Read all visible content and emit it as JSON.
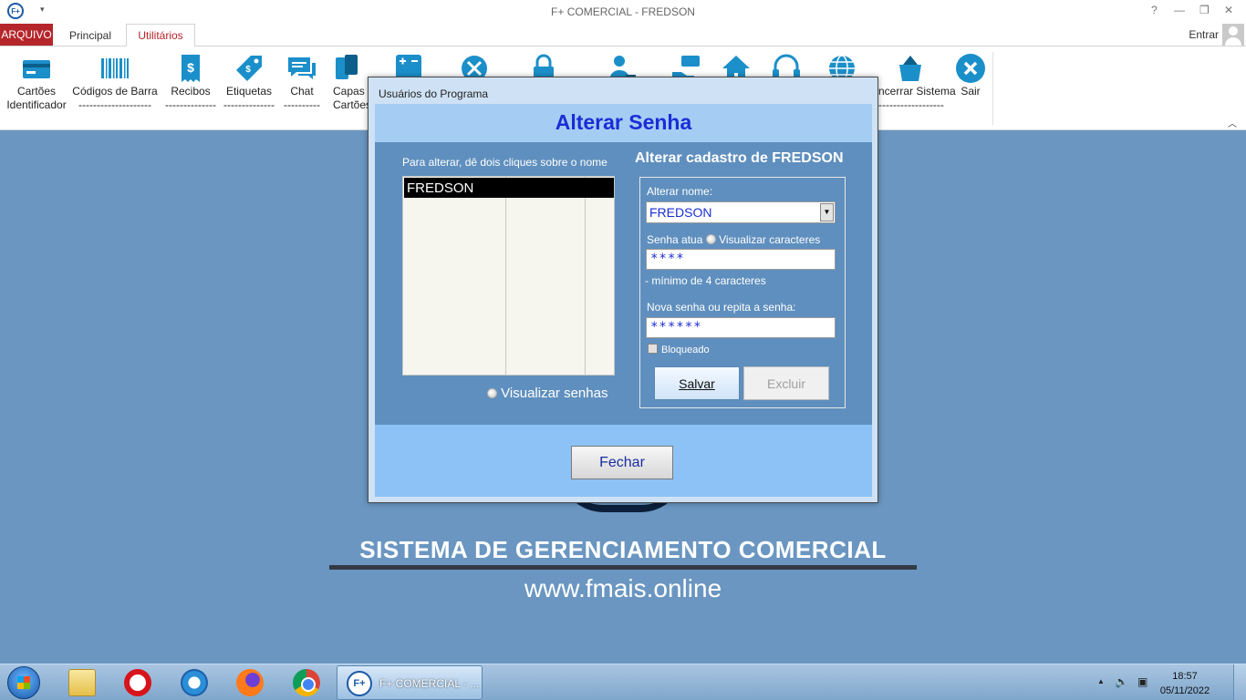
{
  "window": {
    "title": "F+ COMERCIAL - FREDSON",
    "logo_text": "F+",
    "help": "?",
    "minimize": "—",
    "restore": "❐",
    "close": "✕"
  },
  "ribbon": {
    "file_tab": "ARQUIVO",
    "tabs": [
      "Principal",
      "Utilitários"
    ],
    "active_tab": "Utilitários",
    "login_label": "Entrar",
    "buttons": [
      {
        "line1": "Cartões",
        "line2": "Identificador",
        "icon": "card-id-icon"
      },
      {
        "line1": "Códigos de Barra",
        "line2": "--------------------",
        "icon": "barcode-icon"
      },
      {
        "line1": "Recibos",
        "line2": "--------------",
        "icon": "receipt-icon"
      },
      {
        "line1": "Etiquetas",
        "line2": "--------------",
        "icon": "tags-icon"
      },
      {
        "line1": "Chat",
        "line2": "----------",
        "icon": "chat-icon"
      },
      {
        "line1": "Capas e",
        "line2": "Cartões",
        "icon": "card-covers-icon"
      },
      {
        "line1": "",
        "line2": "",
        "icon": "calculator-icon"
      },
      {
        "line1": "",
        "line2": "",
        "icon": "tools-icon"
      },
      {
        "line1": "",
        "line2": "",
        "icon": "lock-icon"
      },
      {
        "line1": "",
        "line2": "",
        "icon": "user-lock-icon"
      },
      {
        "line1": "",
        "line2": "",
        "icon": "payment-icon"
      },
      {
        "line1": "",
        "line2": "",
        "icon": "home-icon"
      },
      {
        "line1": "",
        "line2": "",
        "icon": "headset-icon"
      },
      {
        "line1": "",
        "line2": "",
        "icon": "globe-icon"
      },
      {
        "line1": "Encerrar Sistema",
        "line2": "--------------------",
        "icon": "close-system-icon"
      },
      {
        "line1": "Sair",
        "line2": "",
        "icon": "exit-icon"
      }
    ]
  },
  "background": {
    "heading": "SISTEMA DE GERENCIAMENTO COMERCIAL",
    "url": "www.fmais.online"
  },
  "dialog": {
    "title": "Usuários do Programa",
    "header": "Alterar Senha",
    "hint": "Para alterar, dê dois cliques sobre o nome",
    "users": [
      "FREDSON"
    ],
    "show_passwords_label": "Visualizar senhas",
    "panel_title": "Alterar cadastro de FREDSON",
    "name_label": "Alterar nome:",
    "name_value": "FREDSON",
    "current_pw_label": "Senha atua",
    "show_chars_label": "Visualizar caracteres",
    "current_pw_value": "****",
    "min_hint": "- mínimo de 4 caracteres",
    "new_pw_label": "Nova senha ou repita a senha:",
    "new_pw_value": "******",
    "blocked_label": "Bloqueado",
    "save_label": "Salvar",
    "delete_label": "Excluir",
    "close_label": "Fechar"
  },
  "taskbar": {
    "app_label": "F+ COMERCIAL - ...",
    "app_logo": "F+",
    "time": "18:57",
    "date": "05/11/2022"
  }
}
